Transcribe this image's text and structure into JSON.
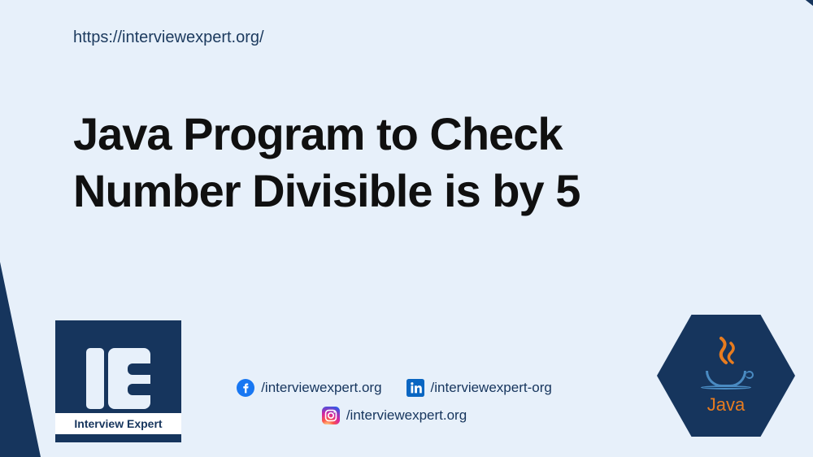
{
  "url": "https://interviewexpert.org/",
  "title_line1": "Java Program to Check",
  "title_line2": "Number Divisible is by 5",
  "logo": {
    "letters": "IE",
    "label": "Interview Expert"
  },
  "social": {
    "facebook": "/interviewexpert.org",
    "linkedin": "/interviewexpert-org",
    "instagram": "/interviewexpert.org"
  },
  "java_logo_text": "Java"
}
